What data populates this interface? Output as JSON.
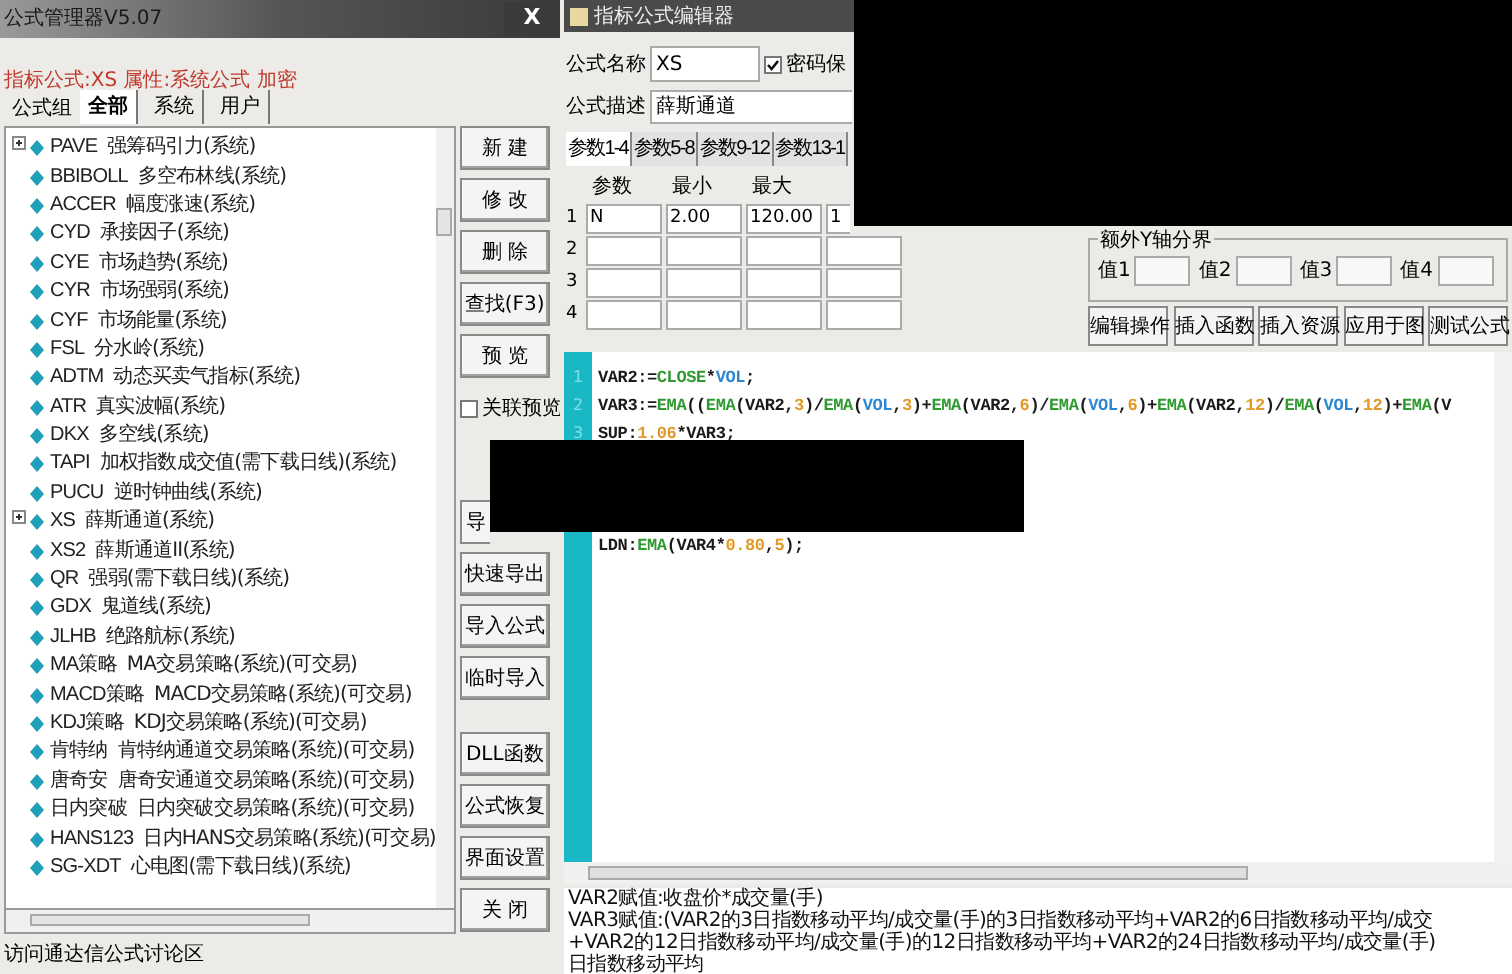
{
  "manager": {
    "title": "公式管理器V5.07",
    "close": "X",
    "info": "指标公式:XS 属性:系统公式 加密",
    "group_label": "公式组",
    "tabs": [
      {
        "label": "全部",
        "selected": true
      },
      {
        "label": "系统",
        "selected": false
      },
      {
        "label": "用户",
        "selected": false
      }
    ],
    "tree": [
      {
        "code": "PAVE",
        "name": "强筹码引力(系统)",
        "expandable": true
      },
      {
        "code": "BBIBOLL",
        "name": "多空布林线(系统)",
        "expandable": false
      },
      {
        "code": "ACCER",
        "name": "幅度涨速(系统)",
        "expandable": false
      },
      {
        "code": "CYD",
        "name": "承接因子(系统)",
        "expandable": false
      },
      {
        "code": "CYE",
        "name": "市场趋势(系统)",
        "expandable": false
      },
      {
        "code": "CYR",
        "name": "市场强弱(系统)",
        "expandable": false
      },
      {
        "code": "CYF",
        "name": "市场能量(系统)",
        "expandable": false
      },
      {
        "code": "FSL",
        "name": "分水岭(系统)",
        "expandable": false
      },
      {
        "code": "ADTM",
        "name": "动态买卖气指标(系统)",
        "expandable": false
      },
      {
        "code": "ATR",
        "name": "真实波幅(系统)",
        "expandable": false
      },
      {
        "code": "DKX",
        "name": "多空线(系统)",
        "expandable": false
      },
      {
        "code": "TAPI",
        "name": "加权指数成交值(需下载日线)(系统)",
        "expandable": false
      },
      {
        "code": "PUCU",
        "name": "逆时钟曲线(系统)",
        "expandable": false
      },
      {
        "code": "XS",
        "name": "薛斯通道(系统)",
        "expandable": true
      },
      {
        "code": "XS2",
        "name": "薛斯通道II(系统)",
        "expandable": false
      },
      {
        "code": "QR",
        "name": "强弱(需下载日线)(系统)",
        "expandable": false
      },
      {
        "code": "GDX",
        "name": "鬼道线(系统)",
        "expandable": false
      },
      {
        "code": "JLHB",
        "name": "绝路航标(系统)",
        "expandable": false
      },
      {
        "code": "MA策略",
        "name": "MA交易策略(系统)(可交易)",
        "expandable": false
      },
      {
        "code": "MACD策略",
        "name": "MACD交易策略(系统)(可交易)",
        "expandable": false
      },
      {
        "code": "KDJ策略",
        "name": "KDJ交易策略(系统)(可交易)",
        "expandable": false
      },
      {
        "code": "肯特纳",
        "name": "肯特纳通道交易策略(系统)(可交易)",
        "expandable": false
      },
      {
        "code": "唐奇安",
        "name": "唐奇安通道交易策略(系统)(可交易)",
        "expandable": false
      },
      {
        "code": "日内突破",
        "name": "日内突破交易策略(系统)(可交易)",
        "expandable": false
      },
      {
        "code": "HANS123",
        "name": "日内HANS交易策略(系统)(可交易)",
        "expandable": false
      },
      {
        "code": "SG-XDT",
        "name": "心电图(需下载日线)(系统)",
        "expandable": false
      }
    ],
    "buttons_top": [
      "新 建",
      "修 改",
      "删 除",
      "查找(F3)",
      "预 览"
    ],
    "preview_checkbox": {
      "label": "关联预览",
      "checked": false
    },
    "buttons_bottom": [
      "导",
      "快速导出",
      "导入公式",
      "临时导入",
      "DLL函数",
      "公式恢复",
      "界面设置",
      "关 闭"
    ],
    "status": "访问通达信公式讨论区"
  },
  "editor": {
    "title": "指标公式编辑器",
    "name_label": "公式名称",
    "name_value": "XS",
    "password": {
      "label": "密码保",
      "checked": true
    },
    "desc_label": "公式描述",
    "desc_value": "薛斯通道",
    "param_tabs": [
      {
        "label": "参数1-4",
        "selected": true
      },
      {
        "label": "参数5-8",
        "selected": false
      },
      {
        "label": "参数9-12",
        "selected": false
      },
      {
        "label": "参数13-1",
        "selected": false
      }
    ],
    "param_columns": [
      "参数",
      "最小",
      "最大"
    ],
    "param_rows": [
      {
        "index": "1",
        "cells": [
          "N",
          "2.00",
          "120.00",
          "1"
        ]
      },
      {
        "index": "2"
      },
      {
        "index": "3"
      },
      {
        "index": "4"
      }
    ],
    "axis_group": {
      "title": "额外Y轴分界",
      "fields": [
        "值1",
        "值2",
        "值3",
        "值4"
      ]
    },
    "actions": [
      "编辑操作",
      "插入函数",
      "插入资源",
      "应用于图",
      "测试公式"
    ],
    "code": [
      {
        "number": "1",
        "tokens": [
          {
            "text": "VAR2:=",
            "kind": "plain"
          },
          {
            "text": "CLOSE",
            "kind": "func"
          },
          {
            "text": "*",
            "kind": "plain"
          },
          {
            "text": "VOL",
            "kind": "var"
          },
          {
            "text": ";",
            "kind": "plain"
          }
        ]
      },
      {
        "number": "2",
        "tokens": [
          {
            "text": "VAR3:=",
            "kind": "plain"
          },
          {
            "text": "EMA",
            "kind": "func"
          },
          {
            "text": "((",
            "kind": "plain"
          },
          {
            "text": "EMA",
            "kind": "func"
          },
          {
            "text": "(VAR2,",
            "kind": "plain"
          },
          {
            "text": "3",
            "kind": "num"
          },
          {
            "text": ")/",
            "kind": "plain"
          },
          {
            "text": "EMA",
            "kind": "func"
          },
          {
            "text": "(",
            "kind": "plain"
          },
          {
            "text": "VOL",
            "kind": "var"
          },
          {
            "text": ",",
            "kind": "plain"
          },
          {
            "text": "3",
            "kind": "num"
          },
          {
            "text": ")+",
            "kind": "plain"
          },
          {
            "text": "EMA",
            "kind": "func"
          },
          {
            "text": "(VAR2,",
            "kind": "plain"
          },
          {
            "text": "6",
            "kind": "num"
          },
          {
            "text": ")/",
            "kind": "plain"
          },
          {
            "text": "EMA",
            "kind": "func"
          },
          {
            "text": "(",
            "kind": "plain"
          },
          {
            "text": "VOL",
            "kind": "var"
          },
          {
            "text": ",",
            "kind": "plain"
          },
          {
            "text": "6",
            "kind": "num"
          },
          {
            "text": ")+",
            "kind": "plain"
          },
          {
            "text": "EMA",
            "kind": "func"
          },
          {
            "text": "(VAR2,",
            "kind": "plain"
          },
          {
            "text": "12",
            "kind": "num"
          },
          {
            "text": ")/",
            "kind": "plain"
          },
          {
            "text": "EMA",
            "kind": "func"
          },
          {
            "text": "(",
            "kind": "plain"
          },
          {
            "text": "VOL",
            "kind": "var"
          },
          {
            "text": ",",
            "kind": "plain"
          },
          {
            "text": "12",
            "kind": "num"
          },
          {
            "text": ")+",
            "kind": "plain"
          },
          {
            "text": "EMA",
            "kind": "func"
          },
          {
            "text": "(V",
            "kind": "plain"
          }
        ]
      },
      {
        "number": "3",
        "tokens": [
          {
            "text": "SUP:",
            "kind": "plain"
          },
          {
            "text": "1.06",
            "kind": "num"
          },
          {
            "text": "*VAR3;",
            "kind": "plain"
          }
        ]
      },
      {
        "tokens": [
          {
            "text": "LDN:",
            "kind": "plain"
          },
          {
            "text": "EMA",
            "kind": "func"
          },
          {
            "text": "(VAR4*",
            "kind": "plain"
          },
          {
            "text": "0.80",
            "kind": "num"
          },
          {
            "text": ",",
            "kind": "plain"
          },
          {
            "text": "5",
            "kind": "num"
          },
          {
            "text": ");",
            "kind": "plain"
          }
        ]
      }
    ],
    "description": [
      "VAR2赋值:收盘价*成交量(手)",
      "VAR3赋值:(VAR2的3日指数移动平均/成交量(手)的3日指数移动平均+VAR2的6日指数移动平均/成交",
      "+VAR2的12日指数移动平均/成交量(手)的12日指数移动平均+VAR2的24日指数移动平均/成交量(手)",
      "日指数移动平均"
    ]
  }
}
